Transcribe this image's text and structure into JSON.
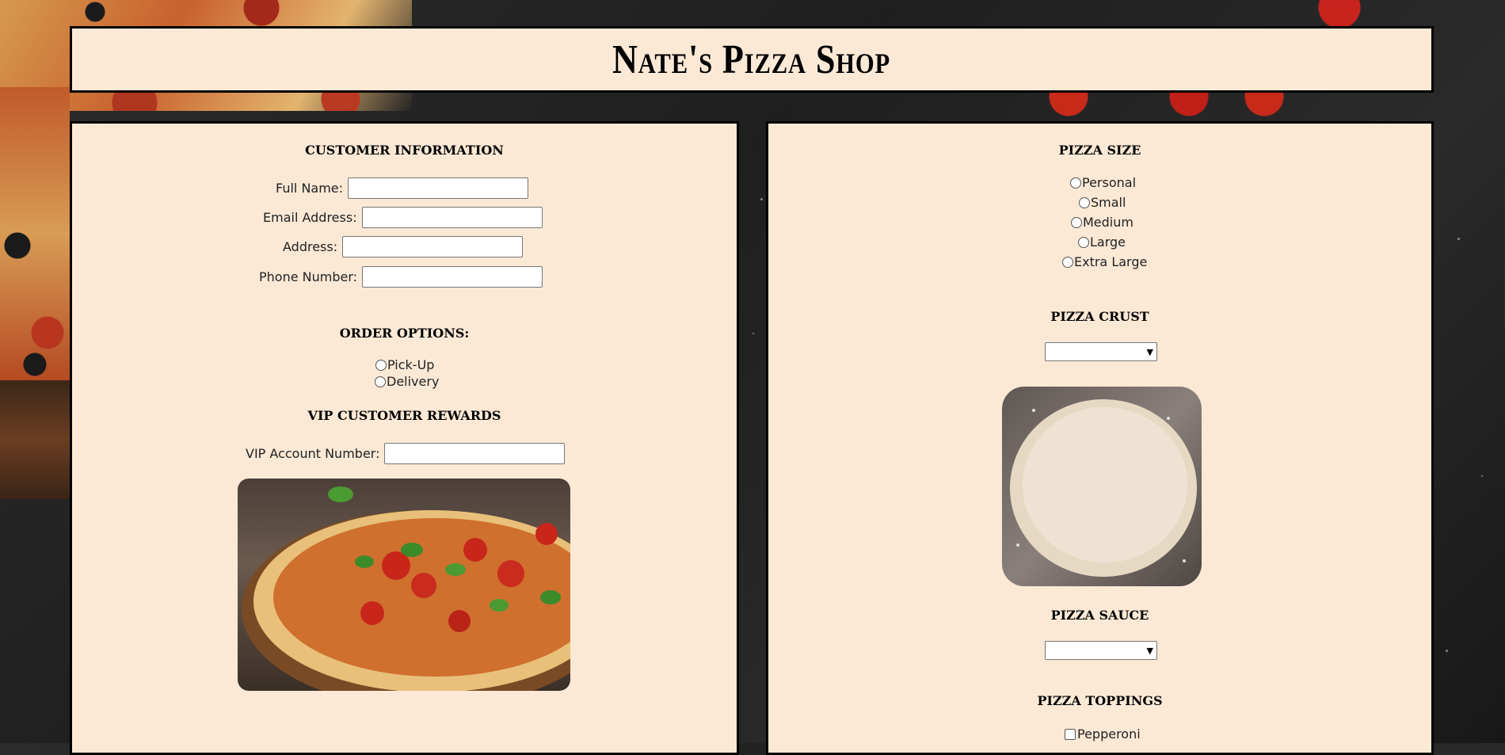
{
  "header": {
    "title": "Nate's Pizza Shop"
  },
  "customer": {
    "title": "Customer Information",
    "fields": [
      {
        "label": "Full Name:",
        "value": ""
      },
      {
        "label": "Email Address:",
        "value": ""
      },
      {
        "label": "Address:",
        "value": ""
      },
      {
        "label": "Phone Number:",
        "value": ""
      }
    ]
  },
  "order_options": {
    "title": "Order Options:",
    "options": [
      "Pick-Up",
      "Delivery"
    ]
  },
  "vip": {
    "title": "VIP Customer Rewards",
    "label": "VIP Account Number:",
    "value": ""
  },
  "pizza_size": {
    "title": "Pizza Size",
    "options": [
      "Personal",
      "Small",
      "Medium",
      "Large",
      "Extra Large"
    ]
  },
  "pizza_crust": {
    "title": "Pizza Crust",
    "selected": ""
  },
  "pizza_sauce": {
    "title": "Pizza Sauce",
    "selected": ""
  },
  "pizza_toppings": {
    "title": "Pizza Toppings",
    "options": [
      "Pepperoni"
    ]
  },
  "icons": {
    "dropdown_caret": "chevron-down-icon",
    "radio": "radio-icon",
    "checkbox": "checkbox-icon"
  },
  "colors": {
    "panel_background": "#fbe9d6",
    "border": "#000000",
    "page_background": "#222222"
  }
}
